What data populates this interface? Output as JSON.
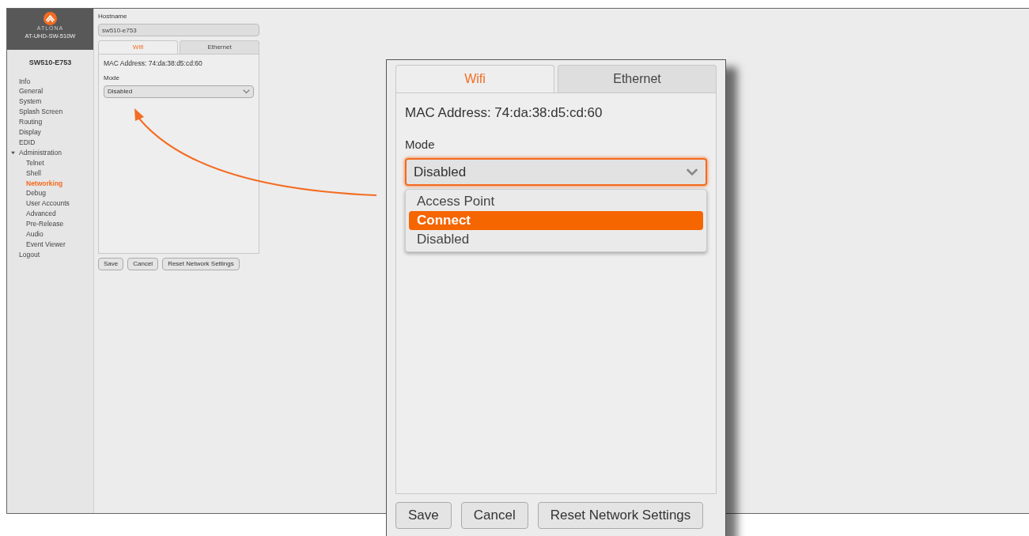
{
  "logo": {
    "brand": "ATLONA",
    "model": "AT-UHD-SW-510W"
  },
  "device_name": "SW510-E753",
  "nav": [
    {
      "label": "Info",
      "selected": false
    },
    {
      "label": "General",
      "selected": false
    },
    {
      "label": "System",
      "selected": false
    },
    {
      "label": "Splash Screen",
      "selected": false
    },
    {
      "label": "Routing",
      "selected": false
    },
    {
      "label": "Display",
      "selected": false
    },
    {
      "label": "EDID",
      "selected": false
    },
    {
      "label": "Administration",
      "selected": false,
      "expanded": true,
      "children": [
        {
          "label": "Telnet",
          "selected": false
        },
        {
          "label": "Shell",
          "selected": false
        },
        {
          "label": "Networking",
          "selected": true
        },
        {
          "label": "Debug",
          "selected": false
        },
        {
          "label": "User Accounts",
          "selected": false
        },
        {
          "label": "Advanced",
          "selected": false
        },
        {
          "label": "Pre-Release",
          "selected": false
        },
        {
          "label": "Audio",
          "selected": false
        },
        {
          "label": "Event Viewer",
          "selected": false
        }
      ]
    },
    {
      "label": "Logout",
      "selected": false
    }
  ],
  "hostname": {
    "label": "Hostname",
    "value": "sw510-e753"
  },
  "tabs": [
    {
      "label": "Wifi",
      "selected": true
    },
    {
      "label": "Ethernet",
      "selected": false
    }
  ],
  "mac": "MAC Address: 74:da:38:d5:cd:60",
  "mode": {
    "label": "Mode",
    "value": "Disabled"
  },
  "buttons": [
    "Save",
    "Cancel",
    "Reset Network Settings"
  ],
  "callout": {
    "tabs": [
      {
        "label": "Wifi",
        "selected": true
      },
      {
        "label": "Ethernet",
        "selected": false
      }
    ],
    "mac": "MAC Address: 74:da:38:d5:cd:60",
    "mode": {
      "label": "Mode",
      "value": "Disabled",
      "focused": true
    },
    "options": [
      {
        "label": "Access Point",
        "selected": false
      },
      {
        "label": "Connect",
        "selected": true
      },
      {
        "label": "Disabled",
        "selected": false
      }
    ],
    "buttons": [
      "Save",
      "Cancel",
      "Reset Network Settings"
    ]
  }
}
